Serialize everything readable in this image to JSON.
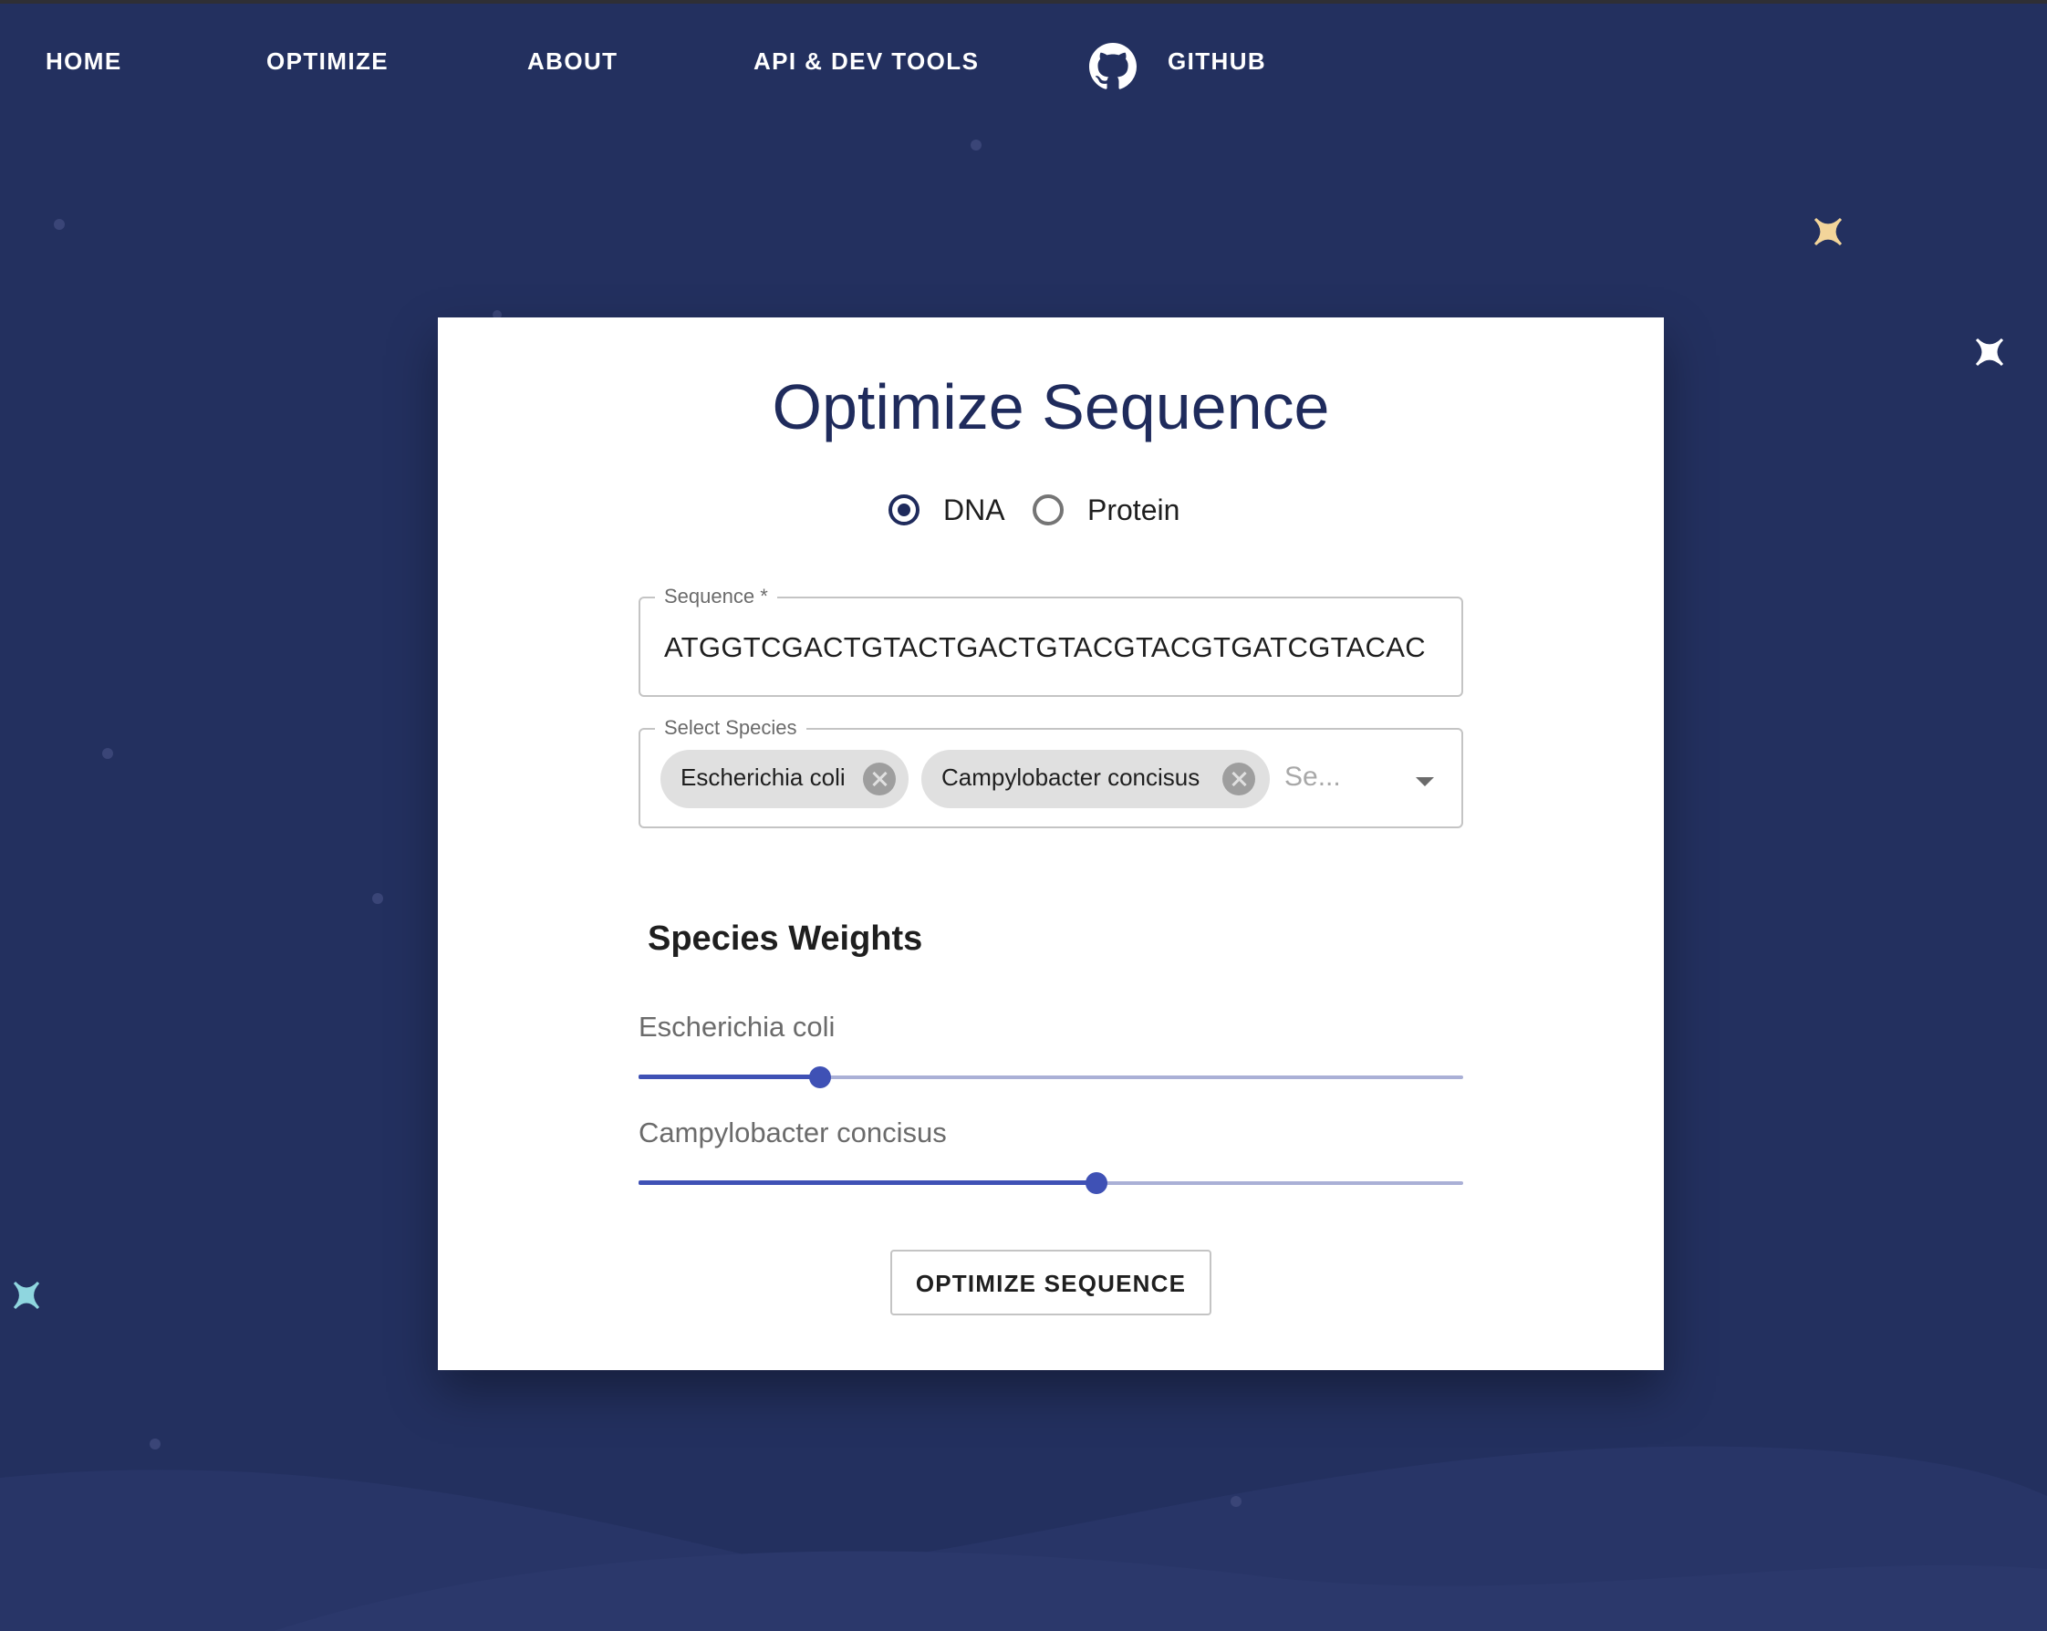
{
  "nav": {
    "items": [
      "HOME",
      "OPTIMIZE",
      "ABOUT",
      "API & DEV TOOLS"
    ],
    "github_label": "GITHUB"
  },
  "card": {
    "title": "Optimize Sequence",
    "sequence_type": {
      "options": [
        "DNA",
        "Protein"
      ],
      "selected": "DNA"
    },
    "sequence_field": {
      "label": "Sequence *",
      "value": "ATGGTCGACTGTACTGACTGTACGTACGTGATCGTACAC"
    },
    "species_field": {
      "label": "Select Species",
      "chips": [
        "Escherichia coli",
        "Campylobacter concisus"
      ],
      "placeholder": "Se..."
    },
    "weights": {
      "title": "Species Weights",
      "sliders": [
        {
          "label": "Escherichia coli",
          "value": 0.22
        },
        {
          "label": "Campylobacter concisus",
          "value": 0.555
        }
      ]
    },
    "button_label": "OPTIMIZE SEQUENCE"
  },
  "colors": {
    "background": "#23305f",
    "primary": "#1f2b5c",
    "slider": "#3f51b5",
    "star_gold": "#f3d59a",
    "star_white": "#ffffff",
    "star_teal": "#8fd6df"
  }
}
